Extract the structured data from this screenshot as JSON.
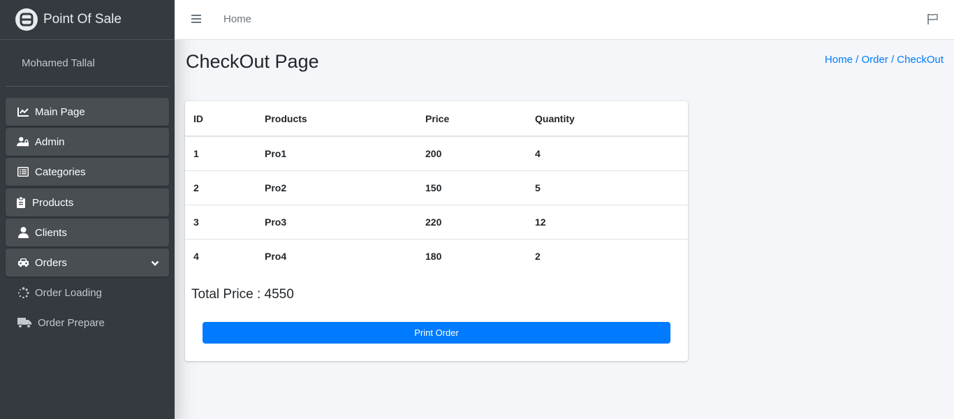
{
  "brand": {
    "title": "Point Of Sale",
    "logo_icon": "app-logo-icon"
  },
  "user": {
    "name": "Mohamed Tallal"
  },
  "sidebar": {
    "items": [
      {
        "label": "Main Page",
        "icon": "chart-line-icon"
      },
      {
        "label": "Admin",
        "icon": "user-lock-icon"
      },
      {
        "label": "Categories",
        "icon": "list-icon"
      },
      {
        "label": "Products",
        "icon": "clipboard-icon"
      },
      {
        "label": "Clients",
        "icon": "user-icon"
      },
      {
        "label": "Orders",
        "icon": "car-icon"
      },
      {
        "label": "Order Loading",
        "icon": "spinner-icon"
      },
      {
        "label": "Order Prepare",
        "icon": "truck-icon"
      }
    ]
  },
  "navbar": {
    "home": "Home"
  },
  "page": {
    "title": "CheckOut Page",
    "breadcrumb": {
      "home": "Home",
      "sep1": " / ",
      "order": "Order",
      "sep2": " / ",
      "checkout": "CheckOut"
    }
  },
  "table": {
    "headers": [
      "ID",
      "Products",
      "Price",
      "Quantity"
    ],
    "rows": [
      [
        "1",
        "Pro1",
        "200",
        "4"
      ],
      [
        "2",
        "Pro2",
        "150",
        "5"
      ],
      [
        "3",
        "Pro3",
        "220",
        "12"
      ],
      [
        "4",
        "Pro4",
        "180",
        "2"
      ]
    ]
  },
  "total": "Total Price : 4550",
  "print_button": "Print Order",
  "colors": {
    "sidebar_bg": "#343a40",
    "primary": "#007bff",
    "content_bg": "#f4f6f9"
  }
}
